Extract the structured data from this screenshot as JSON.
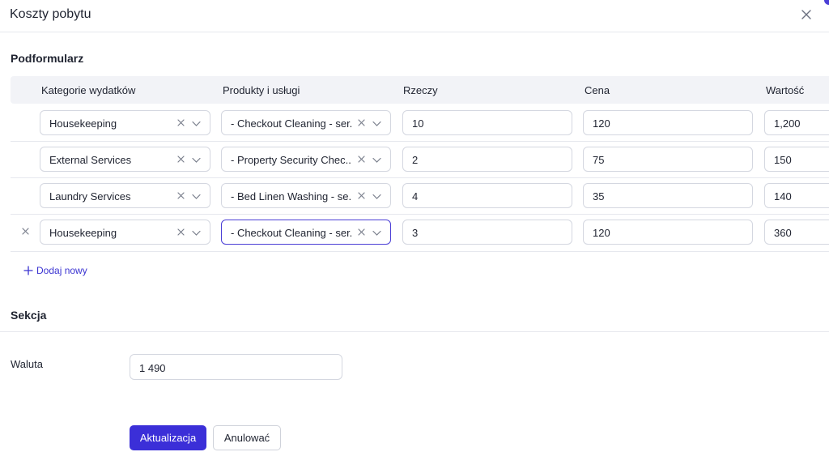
{
  "dialog": {
    "title": "Koszty pobytu",
    "close_icon": "close-icon",
    "accent_color": "#4b3fd6"
  },
  "subform": {
    "title": "Podformularz",
    "columns": [
      "Kategorie wydatków",
      "Produkty i usługi",
      "Rzeczy",
      "Cena",
      "Wartość"
    ],
    "rows": [
      {
        "category": "Housekeeping",
        "product": "- Checkout Cleaning - ser...",
        "qty": "10",
        "price": "120",
        "value": "1,200"
      },
      {
        "category": "External Services",
        "product": "- Property Security Chec...",
        "qty": "2",
        "price": "75",
        "value": "150"
      },
      {
        "category": "Laundry Services",
        "product": "- Bed Linen Washing - se...",
        "qty": "4",
        "price": "35",
        "value": "140"
      },
      {
        "category": "Housekeeping",
        "product": "- Checkout Cleaning - ser...",
        "qty": "3",
        "price": "120",
        "value": "360"
      }
    ],
    "add_new_label": "Dodaj nowy"
  },
  "section": {
    "title": "Sekcja",
    "currency_label": "Waluta",
    "currency_value": "1 490"
  },
  "actions": {
    "update_label": "Aktualizacja",
    "cancel_label": "Anulować",
    "primary_color": "#3b2fd8"
  }
}
